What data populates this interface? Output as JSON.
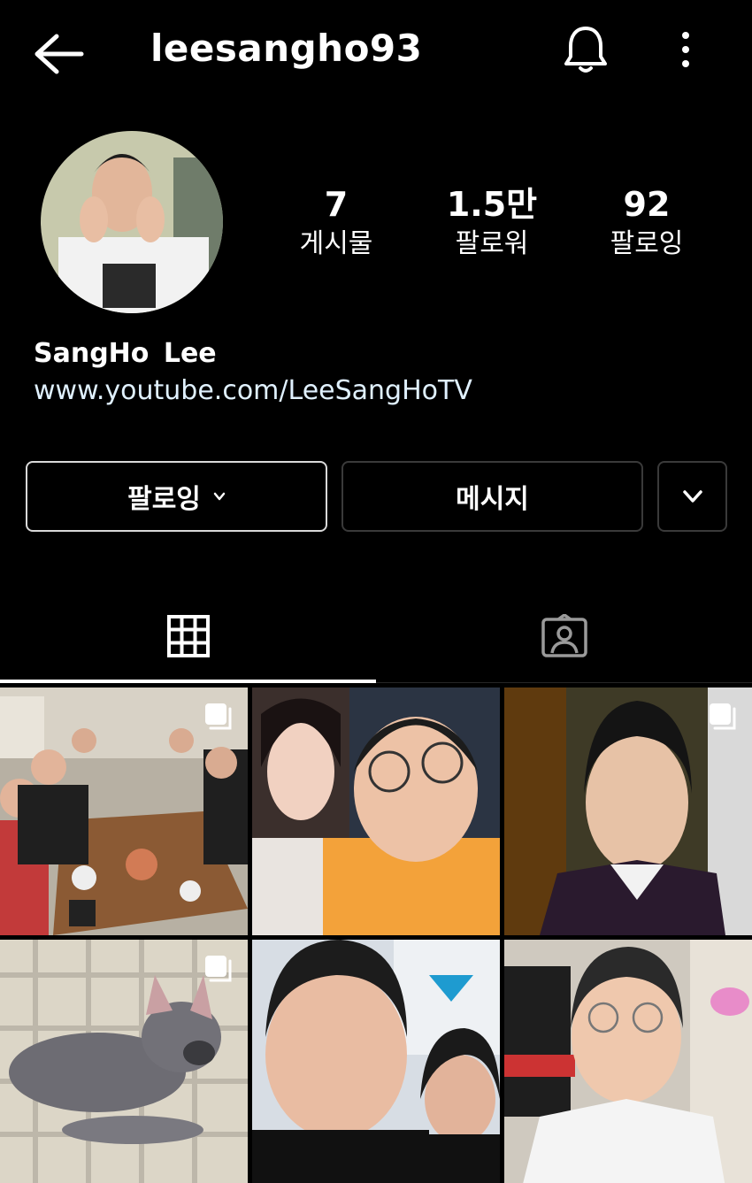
{
  "header": {
    "username": "leesangho93"
  },
  "stats": [
    {
      "value": "7",
      "label": "게시물"
    },
    {
      "value": "1.5만",
      "label": "팔로워"
    },
    {
      "value": "92",
      "label": "팔로잉"
    }
  ],
  "profile": {
    "name": "SangHo  Lee",
    "link": "www.youtube.com/LeeSangHoTV"
  },
  "actions": {
    "follow_label": "팔로잉",
    "message_label": "메시지"
  },
  "tabs": [
    {
      "icon": "grid-icon",
      "active": true
    },
    {
      "icon": "tagged-person-icon",
      "active": false
    }
  ],
  "posts": [
    {
      "description": "group-dinner-photo",
      "multi": true
    },
    {
      "description": "couple-selfie-photo",
      "multi": false
    },
    {
      "description": "portrait-photo",
      "multi": true
    },
    {
      "description": "french-bulldog-photo",
      "multi": true
    },
    {
      "description": "friends-selfie-photo",
      "multi": false
    },
    {
      "description": "room-selfie-photo",
      "multi": false
    }
  ],
  "colors": {
    "background": "#000000",
    "text": "#ffffff",
    "link": "#e0f1ff",
    "border": "#3a3a3a"
  }
}
